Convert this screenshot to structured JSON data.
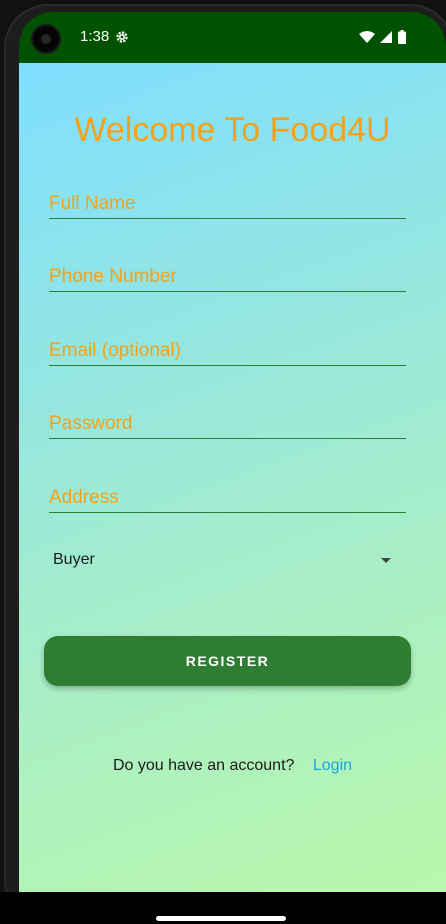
{
  "status_bar": {
    "time": "1:38",
    "icons": [
      "gear-icon",
      "wifi-icon",
      "signal-icon",
      "battery-icon"
    ],
    "background": "#005200"
  },
  "app": {
    "title": "Welcome To Food4U",
    "accent": "#f5a21b",
    "primary": "#2e7d32",
    "fields": {
      "full_name": "Full Name",
      "phone_number": "Phone Number",
      "email": "Email (optional)",
      "password": "Password",
      "address": "Address"
    },
    "role_dropdown": {
      "selected": "Buyer"
    },
    "register_label": "REGISTER",
    "account_question": "Do you have an account?",
    "login_label": "Login"
  }
}
